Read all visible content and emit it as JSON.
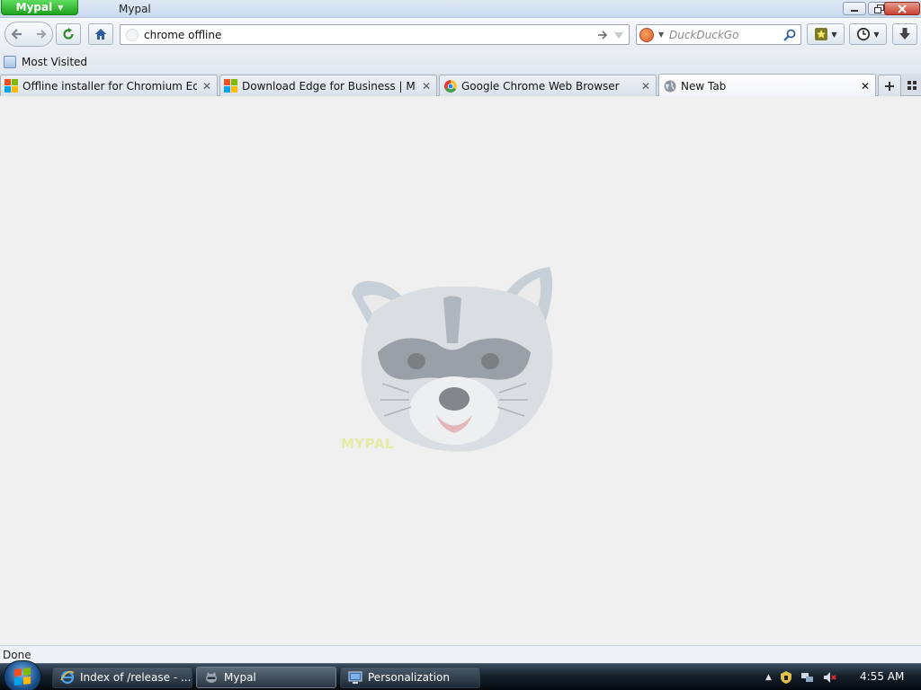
{
  "titlebar": {
    "app_button": "Mypal",
    "window_title": "Mypal"
  },
  "toolbar": {
    "url_value": "chrome offline",
    "search_placeholder": "DuckDuckGo"
  },
  "bookmarks": {
    "items": [
      {
        "label": "Most Visited",
        "icon": "most-visited-icon"
      }
    ]
  },
  "tabs": [
    {
      "label": "Offline installer for Chromium Edge...",
      "icon": "microsoft-logo-icon",
      "selected": false
    },
    {
      "label": "Download Edge for Business | Micro...",
      "icon": "microsoft-logo-icon",
      "selected": false
    },
    {
      "label": "Google Chrome Web Browser",
      "icon": "chrome-logo-icon",
      "selected": false
    },
    {
      "label": "New Tab",
      "icon": "globe-icon",
      "selected": true
    }
  ],
  "content": {
    "mascot_icon": "raccoon-mascot-icon",
    "mascot_text": "MYPAL"
  },
  "status": {
    "text": "Done"
  },
  "taskbar": {
    "items": [
      {
        "label": "Index of /release - ...",
        "icon": "internet-explorer-icon",
        "active": false
      },
      {
        "label": "Mypal",
        "icon": "mypal-icon",
        "active": true
      },
      {
        "label": "Personalization",
        "icon": "personalization-icon",
        "active": false
      }
    ],
    "clock": "4:55 AM"
  },
  "colors": {
    "app_button": "#1fa31f",
    "close_button": "#c8412e",
    "taskbar": "#15202c"
  }
}
